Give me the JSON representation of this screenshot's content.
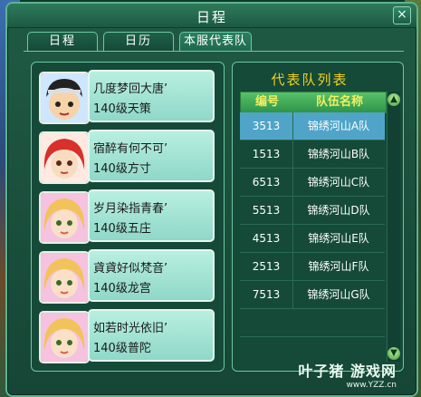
{
  "window": {
    "title": "日程",
    "close": "×"
  },
  "tabs": [
    {
      "label": "日程"
    },
    {
      "label": "日历"
    },
    {
      "label": "本服代表队",
      "active": true
    }
  ],
  "members": [
    {
      "name": "几度梦回大唐’",
      "level": "140级天策",
      "avatar": "boy-black-hair-icon"
    },
    {
      "name": "宿醉有何不可’",
      "level": "140级方寸",
      "avatar": "girl-red-hair-icon"
    },
    {
      "name": "岁月染指青春’",
      "level": "140级五庄",
      "avatar": "girl-blonde-hair-icon"
    },
    {
      "name": "貣貣好似梵音’",
      "level": "140级龙宫",
      "avatar": "girl-blonde-hair-icon"
    },
    {
      "name": "如若时光依旧’",
      "level": "140级普陀",
      "avatar": "girl-blonde-hair-icon"
    }
  ],
  "team_list": {
    "title": "代表队列表",
    "headers": [
      "编号",
      "队伍名称"
    ],
    "rows": [
      {
        "id": "3513",
        "name": "锦绣河山A队",
        "selected": true
      },
      {
        "id": "1513",
        "name": "锦绣河山B队"
      },
      {
        "id": "6513",
        "name": "锦绣河山C队"
      },
      {
        "id": "5513",
        "name": "锦绣河山D队"
      },
      {
        "id": "4513",
        "name": "锦绣河山E队"
      },
      {
        "id": "2513",
        "name": "锦绣河山F队"
      },
      {
        "id": "7513",
        "name": "锦绣河山G队"
      }
    ]
  },
  "watermark": {
    "brand": "叶子猪 游戏网",
    "url": "www.YZZ.cn"
  },
  "colors": {
    "accent": "#6fc7a3",
    "title_gold": "#f0d020",
    "selected_row": "#4fa4c8"
  }
}
